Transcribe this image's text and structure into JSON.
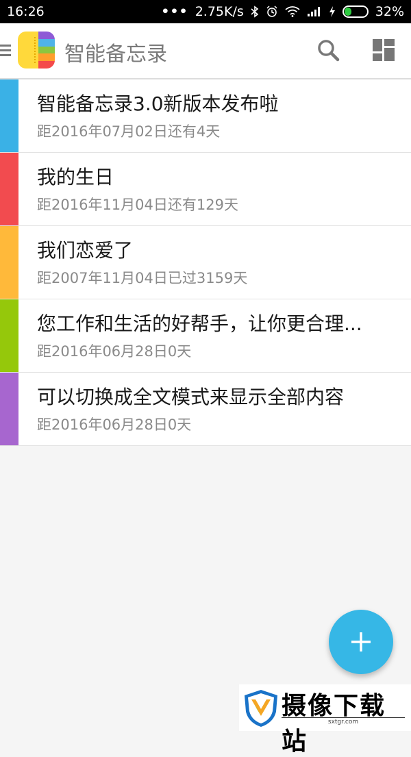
{
  "status_bar": {
    "time": "16:26",
    "dots": "•••",
    "speed": "2.75K/s",
    "battery": "32%",
    "battery_level": 0.32
  },
  "app_bar": {
    "title": "智能备忘录",
    "logo_colors": [
      "#ffd93b",
      "#8e5bd6",
      "#4fb3e8",
      "#8cc63f",
      "#ff9e2c",
      "#f44a4a"
    ]
  },
  "items": [
    {
      "title": "智能备忘录3.0新版本发布啦",
      "subtitle": "距2016年07月02日还有4天",
      "color": "#3ab1e6"
    },
    {
      "title": "我的生日",
      "subtitle": "距2016年11月04日还有129天",
      "color": "#f24b4f"
    },
    {
      "title": "我们恋爱了",
      "subtitle": "距2007年11月04日已过3159天",
      "color": "#ffb93a"
    },
    {
      "title": "您工作和生活的好帮手，让你更合理...",
      "subtitle": "距2016年06月28日0天",
      "color": "#95c80b"
    },
    {
      "title": "可以切换成全文模式来显示全部内容",
      "subtitle": "距2016年06月28日0天",
      "color": "#a766cf"
    }
  ],
  "fab": {
    "icon": "plus-icon",
    "color": "#36b7e6"
  },
  "watermark": {
    "text": "摄像下载站",
    "url": "sxtgr.com"
  }
}
